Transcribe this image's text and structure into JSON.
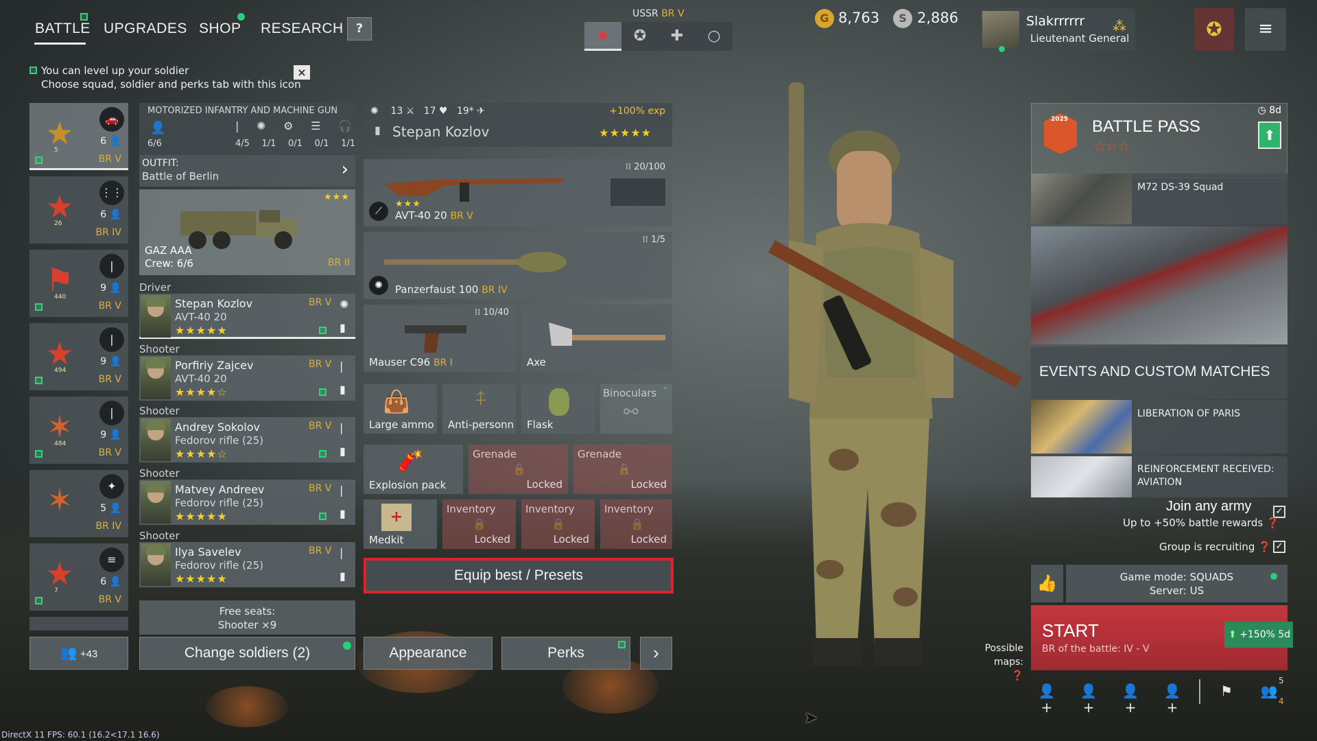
{
  "nav": {
    "tabs": [
      {
        "label": "BATTLE",
        "active": true
      },
      {
        "label": "UPGRADES"
      },
      {
        "label": "SHOP"
      },
      {
        "label": "RESEARCH"
      }
    ],
    "help_label": "?"
  },
  "nation": {
    "name": "USSR",
    "br": "BR V",
    "tab_icons": [
      "star-icon",
      "circle-star-icon",
      "cross-icon",
      "circle-icon"
    ]
  },
  "currency": {
    "gold": "8,763",
    "silver": "2,886",
    "gold_symbol": "G",
    "silver_symbol": "S"
  },
  "player": {
    "name": "Slakrrrrrr",
    "rank": "Lieutenant General"
  },
  "tip": {
    "line1": "You can level up your soldier",
    "line2": "Choose squad, soldier and perks tab with this icon",
    "close": "×"
  },
  "squads": [
    {
      "count": "6",
      "br": "BR V",
      "num": "5",
      "badge": "🚗",
      "emblem": "★"
    },
    {
      "count": "6",
      "br": "BR IV",
      "num": "26",
      "badge": "⋮⋮",
      "emblem": "★"
    },
    {
      "count": "9",
      "br": "BR V",
      "num": "440",
      "badge": "|",
      "emblem": "⚑"
    },
    {
      "count": "9",
      "br": "BR V",
      "num": "494",
      "badge": "|",
      "emblem": "★"
    },
    {
      "count": "9",
      "br": "BR V",
      "num": "484",
      "badge": "|",
      "emblem": "✶"
    },
    {
      "count": "5",
      "br": "BR IV",
      "num": "",
      "badge": "✦",
      "emblem": "✶"
    },
    {
      "count": "6",
      "br": "BR V",
      "num": "7",
      "badge": "≡",
      "emblem": "★"
    }
  ],
  "squad_info": {
    "type": "MOTORIZED INFANTRY AND MACHINE GUN",
    "members": "6/6",
    "slots": [
      "4/5",
      "1/1",
      "0/1",
      "0/1",
      "1/1"
    ]
  },
  "outfit": {
    "label": "OUTFIT:",
    "name": "Battle of Berlin"
  },
  "vehicle": {
    "name": "GAZ AAA",
    "crew": "Crew: 6/6",
    "br": "BR II",
    "stars": "★★★"
  },
  "soldiers": [
    {
      "role": "Driver",
      "name": "Stepan Kozlov",
      "weapon": "AVT-40 20",
      "br": "BR V",
      "stars": "★★★★★"
    },
    {
      "role": "Shooter",
      "name": "Porfiriy Zajcev",
      "weapon": "AVT-40 20",
      "br": "BR V",
      "stars": "★★★★☆"
    },
    {
      "role": "Shooter",
      "name": "Andrey Sokolov",
      "weapon": "Fedorov rifle (25)",
      "br": "BR V",
      "stars": "★★★★☆"
    },
    {
      "role": "Shooter",
      "name": "Matvey Andreev",
      "weapon": "Fedorov rifle (25)",
      "br": "BR V",
      "stars": "★★★★★"
    },
    {
      "role": "Shooter",
      "name": "Ilya Savelev",
      "weapon": "Fedorov rifle (25)",
      "br": "BR V",
      "stars": "★★★★★"
    }
  ],
  "free_seats": {
    "line1": "Free seats:",
    "line2": "Shooter ×9"
  },
  "bottom": {
    "reserve": "+43",
    "change_soldiers": "Change soldiers (2)",
    "appearance": "Appearance",
    "perks": "Perks",
    "next": "›"
  },
  "soldier_detail": {
    "stat1": "13",
    "stat2": "17",
    "stat3": "19*",
    "exp_bonus": "+100% exp",
    "name": "Stepan Kozlov",
    "stars": "★★★★★"
  },
  "equipment": {
    "primary": {
      "name": "AVT-40 20",
      "br": "BR V",
      "ammo": "20/100",
      "stars": "★★★"
    },
    "secondary": {
      "name": "Panzerfaust 100",
      "br": "BR IV",
      "ammo": "1/5"
    },
    "sidearm": {
      "name": "Mauser C96",
      "br": "BR I",
      "ammo": "10/40"
    },
    "melee": {
      "name": "Axe"
    },
    "items": [
      "Large ammo",
      "Anti-personn",
      "Flask",
      "Binoculars"
    ],
    "explosion": "Explosion pack",
    "grenade_slots": [
      {
        "title": "Grenade",
        "status": "Locked"
      },
      {
        "title": "Grenade",
        "status": "Locked"
      }
    ],
    "medkit": "Medkit",
    "inventory_slots": [
      {
        "title": "Inventory",
        "status": "Locked"
      },
      {
        "title": "Inventory",
        "status": "Locked"
      },
      {
        "title": "Inventory",
        "status": "Locked"
      }
    ],
    "equip_best": "Equip best / Presets"
  },
  "battle_pass": {
    "timer": "8d",
    "title": "BATTLE PASS",
    "stars": "☆☆☆",
    "reward": "M72 DS-39 Squad",
    "emblem_year": "2025"
  },
  "events": {
    "title": "EVENTS AND CUSTOM MATCHES",
    "items": [
      "LIBERATION OF PARIS",
      "REINFORCEMENT RECEIVED: AVIATION"
    ]
  },
  "options": {
    "join_army": "Join any army",
    "join_army_sub": "Up to +50% battle rewards",
    "group_recruiting": "Group is recruiting",
    "check": "✓"
  },
  "game_mode": {
    "line1": "Game mode: SQUADS",
    "line2": "Server: US"
  },
  "start": {
    "label": "START",
    "sub": "BR of the battle: IV - V",
    "xp_bonus": "+150% 5d"
  },
  "possible_maps": {
    "line1": "Possible",
    "line2": "maps:"
  },
  "social": {
    "friends_online": "5",
    "friends_total": "4"
  },
  "debug": {
    "fps": "DirectX 11 FPS: 60.1 (16.2<17.1 16.6)"
  }
}
